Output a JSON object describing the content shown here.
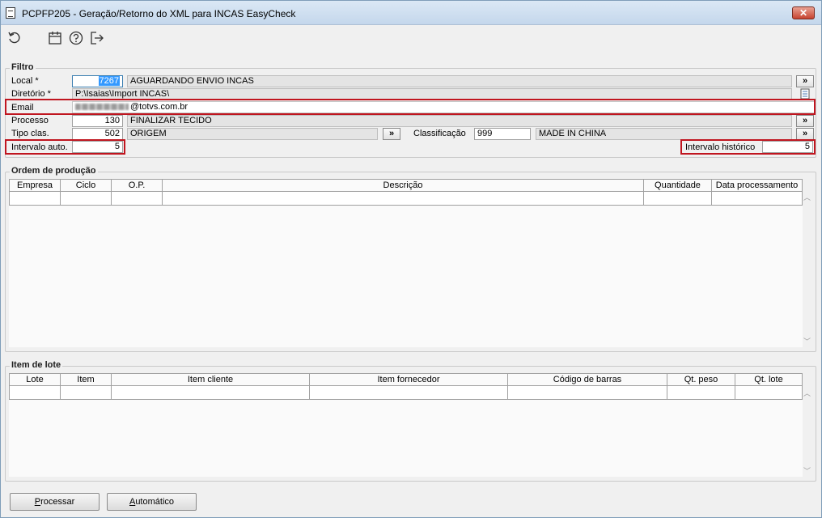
{
  "window": {
    "title": "PCPFP205 - Geração/Retorno do XML para INCAS EasyCheck",
    "close_label": "✕"
  },
  "toolbar": {
    "icons": [
      "undo-icon",
      "calendar-icon",
      "help-icon",
      "exit-icon"
    ]
  },
  "filtro": {
    "title": "Filtro",
    "local": {
      "label": "Local *",
      "code": "7267",
      "description": "AGUARDANDO ENVIO INCAS"
    },
    "diretorio": {
      "label": "Diretório *",
      "value": "P:\\Isaias\\Import INCAS\\"
    },
    "email": {
      "label": "Email",
      "value_visible": "@totvs.com.br"
    },
    "processo": {
      "label": "Processo",
      "code": "130",
      "description": "FINALIZAR TECIDO"
    },
    "tipo_clas": {
      "label": "Tipo clas.",
      "code": "502",
      "description": "ORIGEM"
    },
    "classificacao": {
      "label": "Classificação",
      "code": "999",
      "description": "MADE IN CHINA"
    },
    "intervalo_auto": {
      "label": "Intervalo auto.",
      "value": "5"
    },
    "intervalo_historico": {
      "label": "Intervalo histórico",
      "value": "5"
    },
    "lookup_button_label": "»"
  },
  "ordem_producao": {
    "title": "Ordem de produção",
    "columns": [
      "Empresa",
      "Ciclo",
      "O.P.",
      "Descrição",
      "Quantidade",
      "Data processamento"
    ]
  },
  "item_lote": {
    "title": "Item de lote",
    "columns": [
      "Lote",
      "Item",
      "Item cliente",
      "Item fornecedor",
      "Código de barras",
      "Qt. peso",
      "Qt. lote"
    ]
  },
  "buttons": {
    "processar_prefix": "",
    "processar_underline": "P",
    "processar_rest": "rocessar",
    "automatico_prefix": "",
    "automatico_underline": "A",
    "automatico_rest": "utomático"
  },
  "colors": {
    "highlight_red": "#c0151f",
    "selection_blue": "#3399ff"
  }
}
